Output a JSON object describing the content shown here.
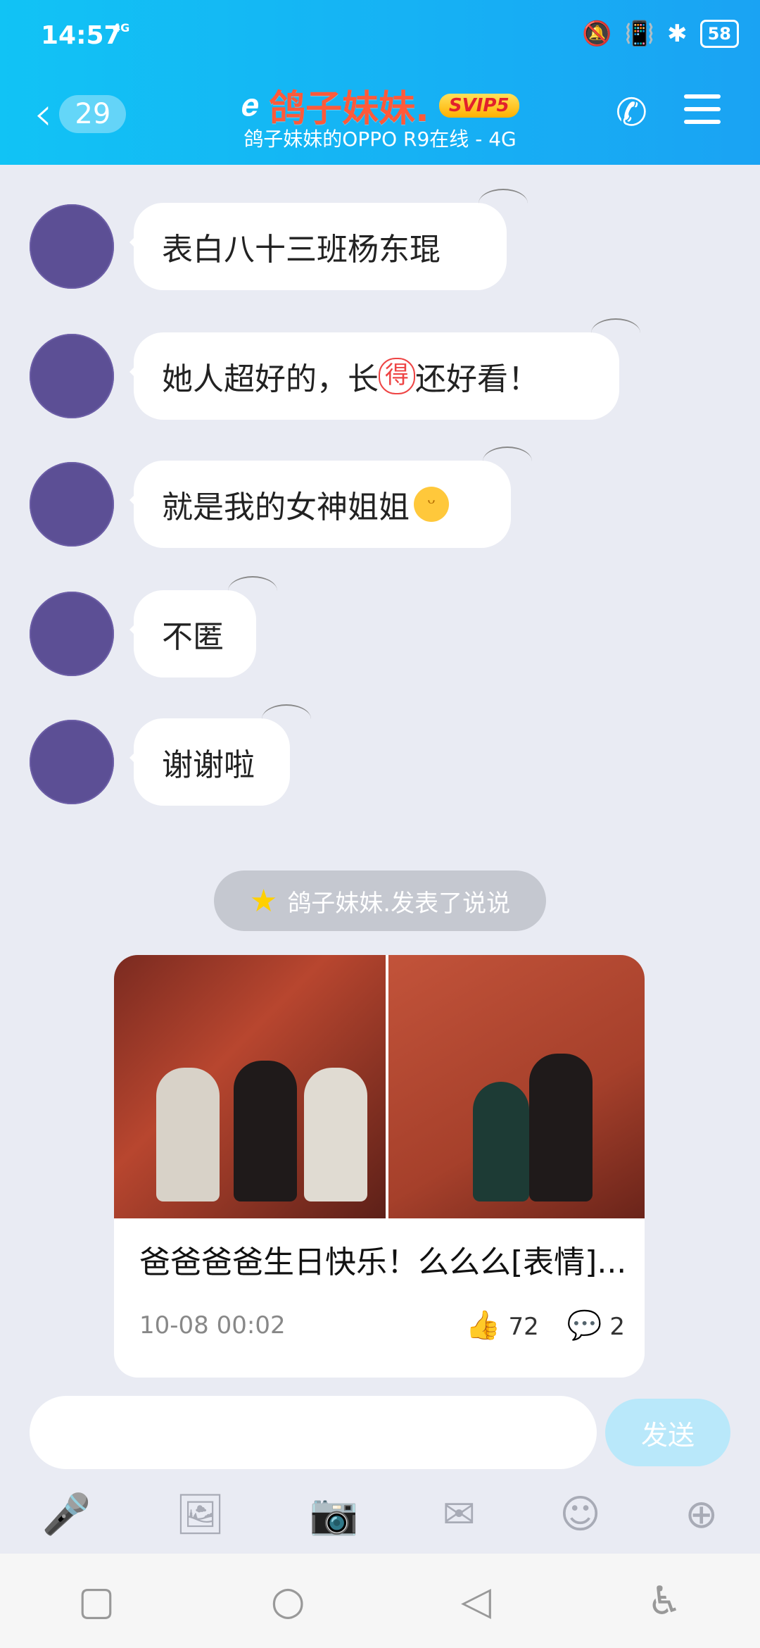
{
  "status": {
    "time": "14:57",
    "network": "4G",
    "battery": "58"
  },
  "header": {
    "unread_count": "29",
    "contact_name": "鸽子妹妹.",
    "vip": "SVIP5",
    "subtitle": "鸽子妹妹的OPPO R9在线 - 4G"
  },
  "messages": [
    {
      "text": "表白八十三班杨东琨"
    },
    {
      "text_a": "她人超好的，长",
      "text_mid": "得",
      "text_b": "还好看！"
    },
    {
      "text": "就是我的女神姐姐"
    },
    {
      "text": "不匿"
    },
    {
      "text": "谢谢啦"
    }
  ],
  "feed_notice": {
    "text": "鸽子妹妹.发表了说说"
  },
  "card": {
    "caption": "爸爸爸爸生日快乐！么么么[表情]...",
    "time": "10-08 00:02",
    "likes": "72",
    "comments": "2"
  },
  "input": {
    "send_label": "发送"
  },
  "icons": {
    "back": "chevron-left-icon",
    "call": "phone-icon",
    "menu": "menu-icon",
    "tools": [
      "microphone-icon",
      "image-icon",
      "camera-icon",
      "red-packet-icon",
      "emoji-icon",
      "plus-icon"
    ]
  }
}
